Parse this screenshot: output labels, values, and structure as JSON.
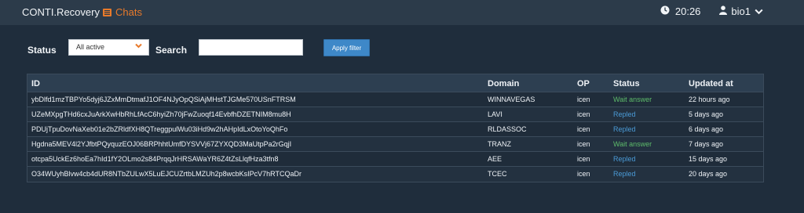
{
  "header": {
    "brand": "CONTI.Recovery",
    "chats_label": "Chats",
    "time": "20:26",
    "username": "bio1",
    "icons": [
      "list-icon",
      "clock-icon",
      "user-icon",
      "chevron-down-icon"
    ]
  },
  "filter": {
    "status_label": "Status",
    "status_selected": "All active",
    "search_label": "Search",
    "search_value": "",
    "apply_label": "Apply filter"
  },
  "table": {
    "columns": [
      "ID",
      "Domain",
      "OP",
      "Status",
      "Updated at"
    ],
    "rows": [
      {
        "id": "ybDlfd1mzTBPYo5dyj6JZxMmDtmafJ1OF4NJyOpQSiAjMHstTJGMe570USnFTRSM",
        "domain": "WINNAVEGAS",
        "op": "icen",
        "status": "Wait answer",
        "updated": "22 hours ago"
      },
      {
        "id": "UZeMXpgTHd6cxJuArkXwHbRhLfAcC6hyiZh70jFwZuoqf14EvbfhDZETNIM8mu8H",
        "domain": "LAVI",
        "op": "icen",
        "status": "Repled",
        "updated": "5 days ago"
      },
      {
        "id": "PDUjTpuDovNaXeb01e2bZRldfXH8QTreggpulWu03iHd9w2hAHpIdLxOtoYoQhFo",
        "domain": "RLDASSOC",
        "op": "icen",
        "status": "Repled",
        "updated": "6 days ago"
      },
      {
        "id": "Hgdna5MEV4l2YJfbtPQyquzEOJ06BRPhhtUmfDYSVVj67ZYXQD3MaUtpPa2rGqjI",
        "domain": "TRANZ",
        "op": "icen",
        "status": "Wait answer",
        "updated": "7 days ago"
      },
      {
        "id": "otcpa5UckEz6hoEa7hId1fY2OLmo2s84PrqqJrHRSAWaYR6Z4tZsLlqfHza3tfn8",
        "domain": "AEE",
        "op": "icen",
        "status": "Repled",
        "updated": "15 days ago"
      },
      {
        "id": "O34WUyhBlvw4cb4dUR8NTbZULwX5LuEJCUZrtbLMZUh2p8wcbKsIPcV7hRTCQaDr",
        "domain": "TCEC",
        "op": "icen",
        "status": "Repled",
        "updated": "20 days ago"
      }
    ]
  },
  "colors": {
    "wait_answer": "#5dbb6a",
    "repled": "#4a9ad6",
    "accent": "#e87a2b",
    "button": "#3e88c8"
  }
}
